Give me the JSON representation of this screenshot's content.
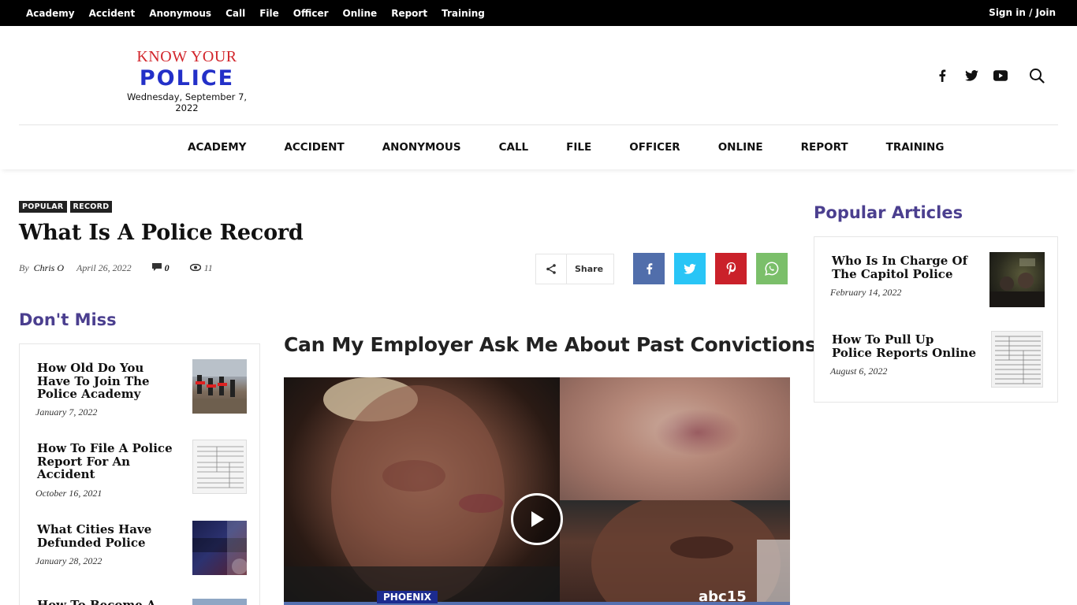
{
  "topbar": {
    "nav": [
      "Academy",
      "Accident",
      "Anonymous",
      "Call",
      "File",
      "Officer",
      "Online",
      "Report",
      "Training"
    ],
    "signin": "Sign in / Join"
  },
  "header": {
    "logo_line1": "KNOW YOUR",
    "logo_line2": "POLICE",
    "date": "Wednesday, September 7, 2022",
    "social_icons": [
      "facebook-icon",
      "twitter-icon",
      "youtube-icon"
    ],
    "search_icon": "search-icon"
  },
  "mainnav": [
    "ACADEMY",
    "ACCIDENT",
    "ANONYMOUS",
    "CALL",
    "FILE",
    "OFFICER",
    "ONLINE",
    "REPORT",
    "TRAINING"
  ],
  "article": {
    "categories": [
      "POPULAR",
      "RECORD"
    ],
    "title": "What Is A Police Record",
    "by": "By",
    "author": "Chris O",
    "date": "April 26, 2022",
    "comments": "0",
    "views": "11",
    "share_label": "Share",
    "share_buttons": [
      {
        "name": "facebook",
        "color": "#516eab"
      },
      {
        "name": "twitter",
        "color": "#29c5f6"
      },
      {
        "name": "pinterest",
        "color": "#ca212a"
      },
      {
        "name": "whatsapp",
        "color": "#7bbf6a"
      }
    ],
    "subheading": "Can My Employer Ask Me About Past Convictions",
    "video": {
      "location_tag": "PHOENIX",
      "channel": "abc15"
    }
  },
  "dont_miss": {
    "title": "Don't Miss",
    "items": [
      {
        "title": "How Old Do You Have To Join The Police Academy",
        "date": "January 7, 2022"
      },
      {
        "title": "How To File A Police Report For An Accident",
        "date": "October 16, 2021"
      },
      {
        "title": "What Cities Have Defunded Police",
        "date": "January 28, 2022"
      },
      {
        "title": "How To Become A",
        "date": ""
      }
    ]
  },
  "popular": {
    "title": "Popular Articles",
    "items": [
      {
        "title": "Who Is In Charge Of The Capitol Police",
        "date": "February 14, 2022"
      },
      {
        "title": "How To Pull Up Police Reports Online",
        "date": "August 6, 2022"
      }
    ]
  }
}
